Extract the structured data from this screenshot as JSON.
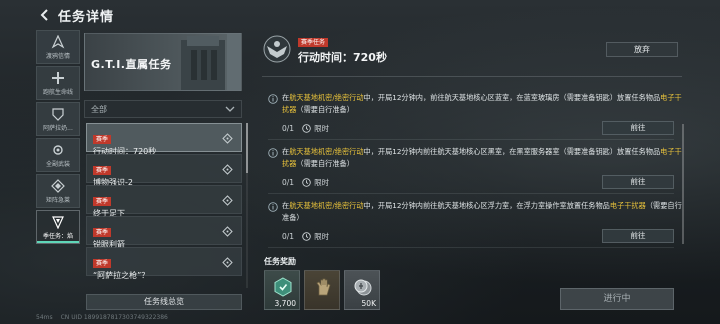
{
  "header": {
    "title": "任务详情"
  },
  "nav": [
    {
      "label": "渡鸦信情",
      "icon": "raven-icon"
    },
    {
      "label": "跑航生命线",
      "icon": "cross-icon"
    },
    {
      "label": "阿萨拉奶...",
      "icon": "shield-icon"
    },
    {
      "label": "全副武装",
      "icon": "gear-icon"
    },
    {
      "label": "矩阵急莱",
      "icon": "diamond-icon"
    },
    {
      "label": "季任务：焰",
      "icon": "season-icon",
      "active": true
    }
  ],
  "banner": {
    "title": "G.T.I.直属任务"
  },
  "filter": {
    "label": "全部"
  },
  "quests": [
    {
      "tag": "赛季",
      "name": "行动时间：720秒",
      "active": true
    },
    {
      "tag": "赛季",
      "name": "博物强识-2"
    },
    {
      "tag": "赛季",
      "name": "终于足下"
    },
    {
      "tag": "赛季",
      "name": "锐眼利箭"
    },
    {
      "tag": "赛季",
      "name": "“阿萨拉之枪”？"
    }
  ],
  "overview_button": "任务线总览",
  "detail": {
    "tag": "赛季任务",
    "title": "行动时间：720秒",
    "abandon": "放弃"
  },
  "objectives": [
    {
      "pre": "在",
      "hl1": "航天基地机密/绝密行动",
      "mid": "中，开局12分钟内，前往航天基地核心区蓝室，在蓝室玻璃房（需要准备钥匙）放置任务物品",
      "hl2": "电子干扰器",
      "post": "（需要自行准备）",
      "progress": "0/1",
      "limit": "限时",
      "button": "前往"
    },
    {
      "pre": "在",
      "hl1": "航天基地机密/绝密行动",
      "mid": "中，开局12分钟内前往航天基地核心区黑室，在黑室服务器室（需要准备钥匙）放置任务物品",
      "hl2": "电子干扰器",
      "post": "（需要自行准备）",
      "progress": "0/1",
      "limit": "限时",
      "button": "前往"
    },
    {
      "pre": "在",
      "hl1": "航天基地机密/绝密行动",
      "mid": "中，开局12分钟内前往航天基地核心区浮力室，在浮力室操作室放置任务物品",
      "hl2": "电子干扰器",
      "post": "（需要自行准备）",
      "progress": "0/1",
      "limit": "限时",
      "button": "前往"
    }
  ],
  "rewards": {
    "label": "任务奖励",
    "items": [
      {
        "icon": "currency-badge-icon",
        "amount": "3,700"
      },
      {
        "icon": "glove-icon",
        "amount": ""
      },
      {
        "icon": "coin-icon",
        "amount": "50K"
      }
    ]
  },
  "status_button": "进行中",
  "status_bar": {
    "ping": "54ms",
    "uid": "CN UID 1899187817303749322386"
  },
  "colors": {
    "accent": "#5fd6b8",
    "tag_red": "#c0392b",
    "highlight": "#e8c23b"
  }
}
